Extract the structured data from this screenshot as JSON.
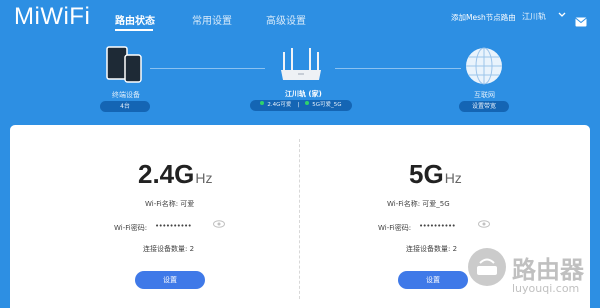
{
  "header": {
    "logo": "MiWiFi",
    "nav": [
      "路由状态",
      "常用设置",
      "高级设置"
    ],
    "mesh_link": "添加Mesh节点路由",
    "user_menu": "江川轨",
    "icons": {
      "chevron": "chevron-down-icon",
      "mail": "mail-icon"
    }
  },
  "topology": {
    "devices": {
      "label": "终端设备",
      "badge": "4台",
      "icon": "tablet-phone-icon"
    },
    "router": {
      "name": "江川轨 (家)",
      "wifi_24": "2.4G可爱",
      "wifi_5": "5G可爱_5G",
      "status_color": "#30d26a",
      "icon": "router-icon"
    },
    "internet": {
      "label": "互联网",
      "badge": "设置带宽",
      "icon": "globe-icon"
    }
  },
  "wifi": {
    "band24": {
      "band": "2.4G",
      "unit": "Hz",
      "name_line": "Wi-Fi名称: 可爱",
      "pwd_label": "Wi-Fi密码:",
      "pwd_mask": "••••••••••",
      "count_line": "连接设备数量: 2",
      "button": "设置"
    },
    "band5": {
      "band": "5G",
      "unit": "Hz",
      "name_line": "Wi-Fi名称: 可爱_5G",
      "pwd_label": "Wi-Fi密码:",
      "pwd_mask": "••••••••••",
      "count_line": "连接设备数量: 2",
      "button": "设置"
    }
  },
  "watermark": {
    "text": "路由器",
    "sub": "luyouqi.com"
  },
  "colors": {
    "background": "#2d8fe3",
    "panel": "#ffffff",
    "button": "#3f79e8",
    "pill": "#1465b4"
  }
}
